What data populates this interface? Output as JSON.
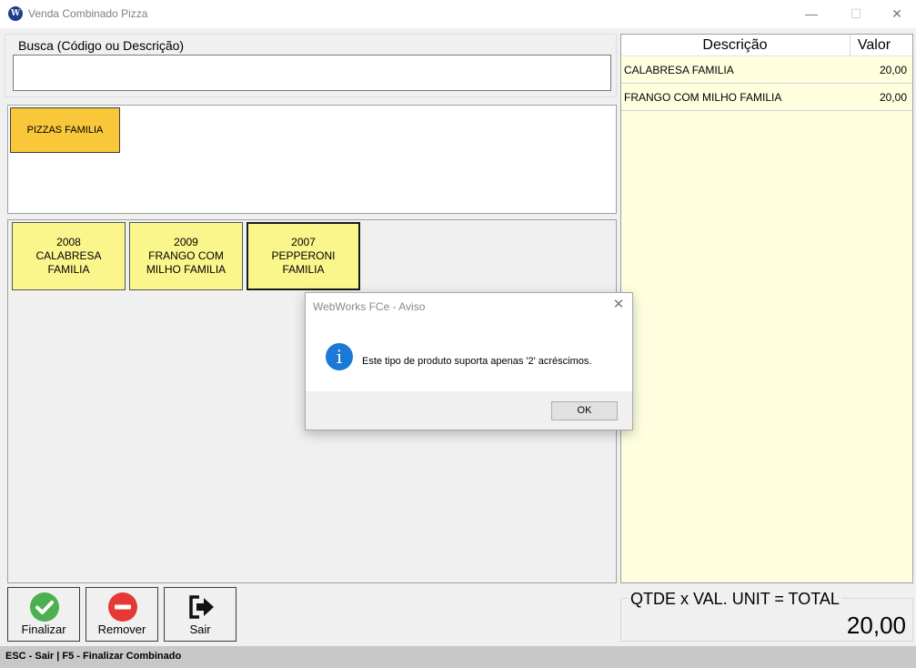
{
  "window": {
    "title": "Venda Combinado Pizza",
    "app_icon_text": "W",
    "minimize": "—",
    "maximize": "☐",
    "close": "✕"
  },
  "search": {
    "label": "Busca (Código ou Descrição)",
    "value": "",
    "placeholder": ""
  },
  "groups": [
    {
      "label": "PIZZAS FAMILIA"
    }
  ],
  "products": [
    {
      "code": "2008",
      "line1": "CALABRESA",
      "line2": "FAMILIA"
    },
    {
      "code": "2009",
      "line1": "FRANGO COM",
      "line2": "MILHO FAMILIA"
    },
    {
      "code": "2007",
      "line1": "PEPPERONI",
      "line2": "FAMILIA"
    }
  ],
  "items_grid": {
    "headers": {
      "description": "Descrição",
      "value": "Valor"
    },
    "rows": [
      {
        "description": "CALABRESA FAMILIA",
        "value": "20,00"
      },
      {
        "description": "FRANGO COM MILHO FAMILIA",
        "value": "20,00"
      }
    ]
  },
  "total": {
    "label": "QTDE x VAL. UNIT = TOTAL",
    "value": "20,00"
  },
  "actions": {
    "finalizar": "Finalizar",
    "remover": "Remover",
    "sair": "Sair"
  },
  "status_bar": "ESC - Sair | F5 - Finalizar Combinado",
  "dialog": {
    "title": "WebWorks FCe - Aviso",
    "icon_text": "i",
    "message": "Este tipo de produto suporta apenas '2' acréscimos.",
    "ok": "OK",
    "close": "✕"
  },
  "colors": {
    "group_button": "#f8c83a",
    "product_button": "#fbf68c",
    "grid_background": "#ffffe0",
    "finalizar_icon": "#4caf50",
    "remover_icon": "#e53935",
    "info_icon": "#1a79d6"
  }
}
